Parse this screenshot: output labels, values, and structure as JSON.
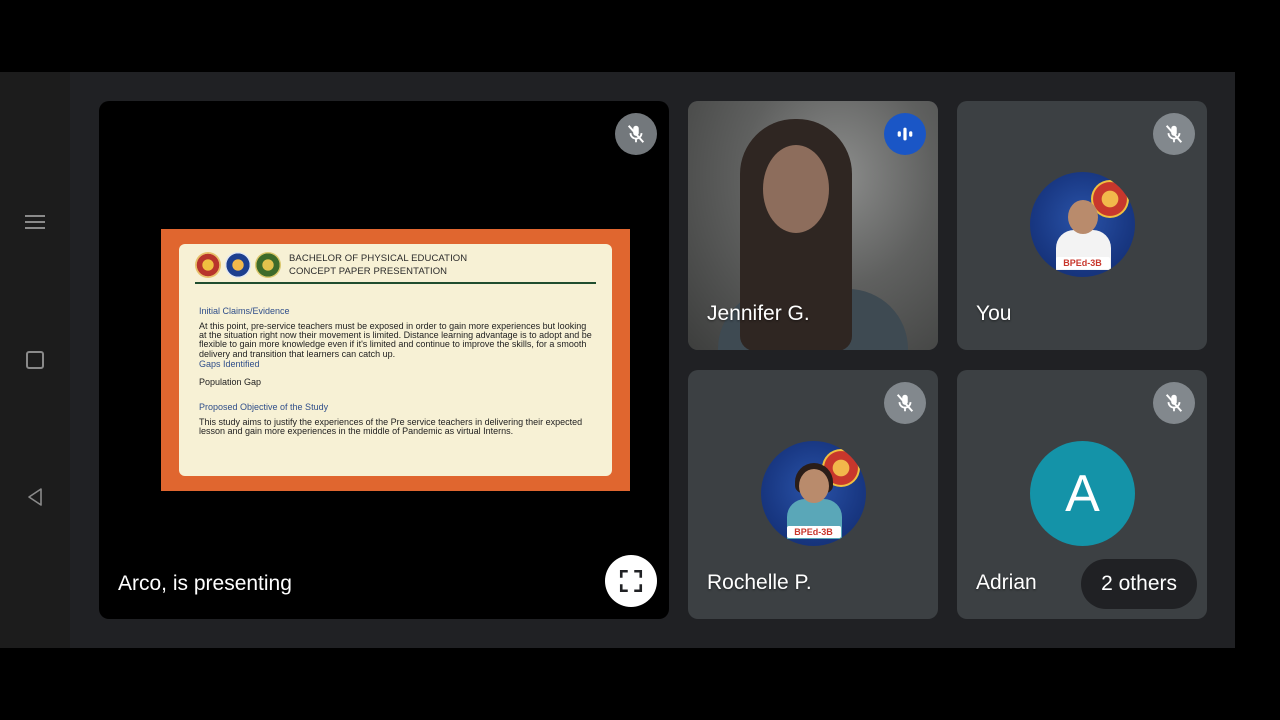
{
  "slide": {
    "heading_line1": "BACHELOR OF PHYSICAL EDUCATION",
    "heading_line2": "CONCEPT PAPER PRESENTATION",
    "sec1_title": "Initial Claims/Evidence",
    "sec1_text": "At this point, pre-service teachers must be exposed in order to gain more experiences but looking at the situation right now their movement is limited. Distance learning advantage is to adopt and be flexible to gain more knowledge even if it's limited and continue to improve the skills, for a smooth delivery and transition that learners can catch up.",
    "sec2_title": "Gaps Identified",
    "sec2_text": "Population Gap",
    "sec3_title": "Proposed Objective of the Study",
    "sec3_text": "This study aims to justify the experiences of the Pre service teachers in delivering their expected lesson and gain more experiences in the middle of Pandemic as virtual Interns."
  },
  "presenter": {
    "label": "Arco, is presenting"
  },
  "participants": [
    {
      "name": "Jennifer G.",
      "mic": "speaking"
    },
    {
      "name": "You",
      "mic": "muted",
      "badge": "BPEd-3B"
    },
    {
      "name": "Rochelle P.",
      "mic": "muted",
      "badge": "BPEd-3B"
    },
    {
      "name": "Adrian",
      "mic": "muted",
      "initial": "A"
    }
  ],
  "others": {
    "label": "2 others"
  },
  "colors": {
    "stage": "#202124",
    "tile": "#3c4043",
    "speaking": "#1a56c6",
    "slide_border": "#e0662f"
  }
}
